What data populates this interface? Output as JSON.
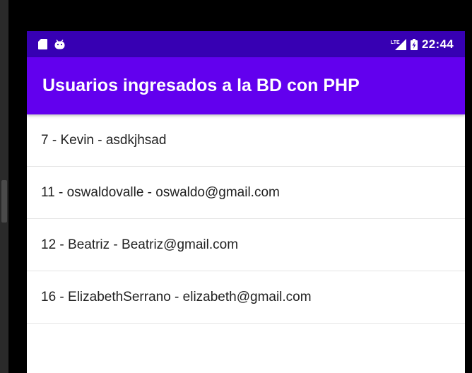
{
  "status_bar": {
    "time": "22:44",
    "network_label": "LTE",
    "left_icons": [
      "sd-card-icon",
      "android-icon"
    ],
    "right_icons": [
      "signal-icon",
      "battery-icon"
    ],
    "color": "#3700b3"
  },
  "app_bar": {
    "title": "Usuarios ingresados a la BD con PHP",
    "color": "#6200ee"
  },
  "users": [
    "7 - Kevin - asdkjhsad",
    "11 - oswaldovalle - oswaldo@gmail.com",
    "12 - Beatriz - Beatriz@gmail.com",
    "16 - ElizabethSerrano - elizabeth@gmail.com"
  ]
}
